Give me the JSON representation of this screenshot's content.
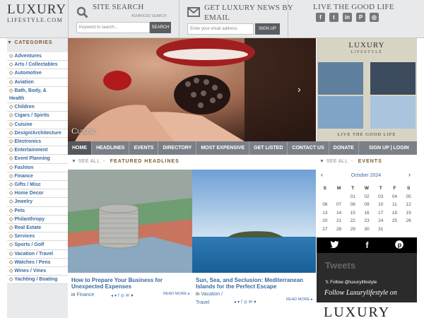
{
  "brand": {
    "logo_main": "LUXURY",
    "logo_sub": "LIFESTYLE.COM"
  },
  "search": {
    "title": "SITE SEARCH",
    "advanced": "ADVANCED SEARCH",
    "placeholder": "Keyword to search...",
    "button": "SEARCH"
  },
  "news": {
    "title_line1": "GET LUXURY NEWS BY",
    "title_line2": "EMAIL",
    "placeholder": "Enter your email address",
    "button": "SIGN UP"
  },
  "social_header": {
    "title": "LIVE THE GOOD LIFE",
    "icons": [
      "facebook-icon",
      "twitter-icon",
      "linkedin-icon",
      "pinterest-icon",
      "instagram-icon"
    ]
  },
  "sidebar": {
    "heading": "CATEGORIES",
    "items": [
      "Adventures",
      "Arts / Collectables",
      "Automotive",
      "Aviation",
      "Bath, Body, &",
      "Health",
      "Children",
      "Cigars / Spirits",
      "Cuisine",
      "Design/Architecture",
      "Electronics",
      "Entertainment",
      "Event Planning",
      "Fashion",
      "Finance",
      "Gifts / Misc",
      "Home Decor",
      "Jewelry",
      "Pets",
      "Philanthropy",
      "Real Estate",
      "Services",
      "Sports / Golf",
      "Vacation / Travel",
      "Watches / Pens",
      "Wines / Vines",
      "Yachting / Boating"
    ]
  },
  "hero": {
    "label": "Cuisine"
  },
  "ad": {
    "logo_main": "LUXURY",
    "logo_sub": "LIFESTYLE",
    "tagline": "LIVE THE GOOD LIFE"
  },
  "nav": {
    "items": [
      "HOME",
      "HEADLINES",
      "EVENTS",
      "DIRECTORY",
      "MOST EXPENSIVE",
      "GET LISTED",
      "CONTACT US",
      "DONATE"
    ],
    "auth": "SIGN UP | LOGIN"
  },
  "featured": {
    "see_all": "See All",
    "heading": "FEATURED HEADLINES",
    "articles": [
      {
        "title": "How to Prepare Your Business for Unexpected Expenses",
        "prefix": "in",
        "category": "Finance",
        "read_more": "READ MORE"
      },
      {
        "title": "Sun, Sea, and Seclusion: Mediterranean Islands for the Perfect Escape",
        "prefix": "in",
        "category": "Vacation / Travel",
        "read_more": "READ MORE"
      }
    ]
  },
  "events": {
    "see_all": "See All",
    "heading": "EVENTS",
    "month": "October 2024",
    "weekdays": [
      "S",
      "M",
      "T",
      "W",
      "T",
      "F",
      "S"
    ],
    "days": [
      "",
      "",
      "01",
      "02",
      "03",
      "04",
      "05",
      "06",
      "07",
      "08",
      "09",
      "10",
      "11",
      "12",
      "13",
      "14",
      "15",
      "16",
      "17",
      "18",
      "19",
      "20",
      "21",
      "22",
      "23",
      "24",
      "25",
      "26",
      "27",
      "28",
      "29",
      "30",
      "31",
      "",
      ""
    ]
  },
  "tweets": {
    "title": "Tweets",
    "follow": "Follow @luxurylifestyle",
    "follow2": "Follow Luxurylifestyle on",
    "logo": "LUXURY"
  }
}
